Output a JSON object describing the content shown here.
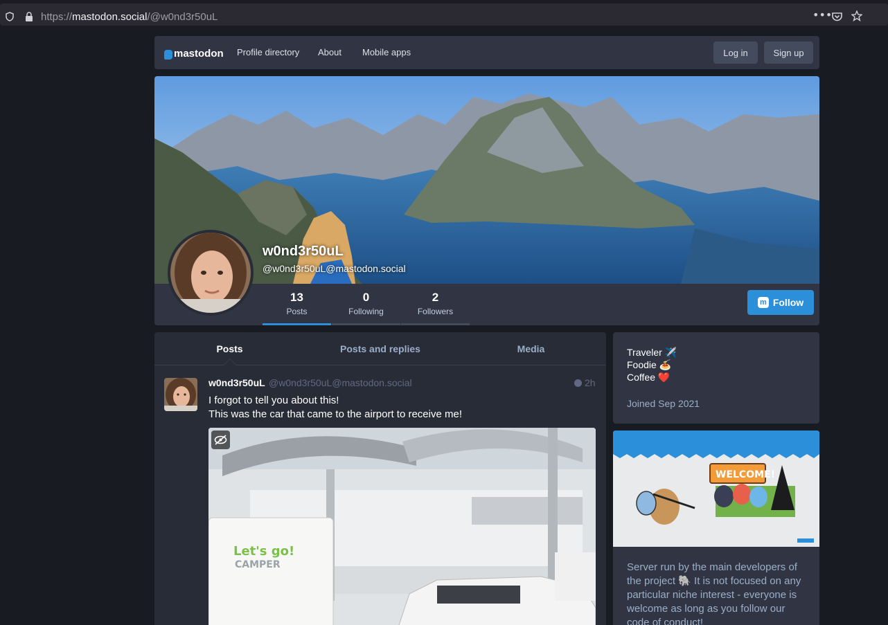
{
  "browser": {
    "url_scheme": "https://",
    "url_host": "mastodon.social",
    "url_path": "/@w0nd3r50uL",
    "icons": [
      "shield-icon",
      "lock-icon",
      "more-icon",
      "pocket-icon",
      "star-icon"
    ]
  },
  "nav": {
    "logo": "mastodon",
    "links": [
      "Profile directory",
      "About",
      "Mobile apps"
    ],
    "login": "Log in",
    "signup": "Sign up"
  },
  "profile": {
    "display_name": "w0nd3r50uL",
    "account": "@w0nd3r50uL@mastodon.social",
    "stats": [
      {
        "value": "13",
        "label": "Posts"
      },
      {
        "value": "0",
        "label": "Following"
      },
      {
        "value": "2",
        "label": "Followers"
      }
    ],
    "follow_label": "Follow"
  },
  "tabs": [
    "Posts",
    "Posts and replies",
    "Media"
  ],
  "status": {
    "name": "w0nd3r50uL",
    "account": "@w0nd3r50uL@mastodon.social",
    "time": "2h",
    "line1": "I forgot to tell you about this!",
    "line2": "This was the car that came to the airport to receive me!",
    "media_text_1": "Let's go!",
    "media_text_2": "CAMPER"
  },
  "bio": {
    "line1": "Traveler ✈️",
    "line2": "Foodie 🍝",
    "line3": "Coffee ❤️",
    "joined": "Joined Sep 2021"
  },
  "server": {
    "banner_text": "WELCOME!",
    "line1": "Server run by the main developers of",
    "line2": "the project 🐘 It is not focused on any",
    "line3": "particular niche interest - everyone is",
    "line4": "welcome as long as you follow our",
    "line5": "code of conduct!"
  },
  "colors": {
    "accent": "#2b90d9",
    "background": "#191b22",
    "panel": "#313543",
    "timeline": "#282c37"
  }
}
